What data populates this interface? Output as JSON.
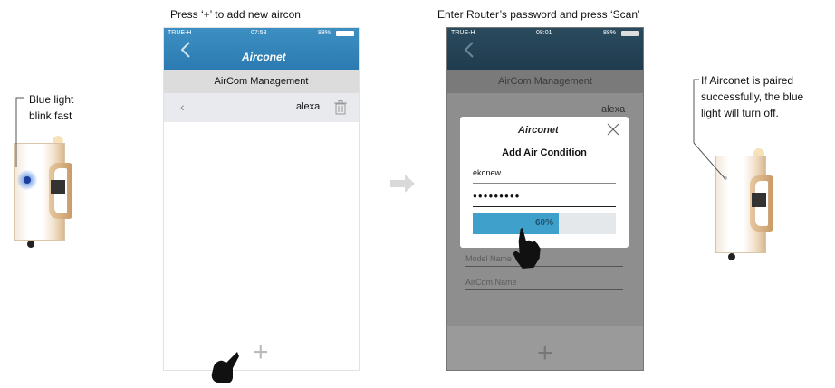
{
  "captions": {
    "step2": "Press ‘+’ to add new aircon",
    "step3": "Enter Router’s password and press ‘Scan’"
  },
  "notes": {
    "left_line1": "Blue light",
    "left_line2": "blink fast",
    "right_line1": "If Airconet is paired",
    "right_line2": "successfully, the blue",
    "right_line3": "light will turn off."
  },
  "phone1": {
    "status": {
      "carrier": "TRUE-H",
      "time": "07:58",
      "battery": "88%"
    },
    "logo": "Airconet",
    "header_title": "AirCom Management",
    "device_name": "alexa",
    "add_icon": "+"
  },
  "phone2": {
    "status": {
      "carrier": "TRUE-H",
      "time": "08:01",
      "battery": "88%"
    },
    "header_title": "AirCom Management",
    "device_name": "alexa",
    "dim_field1": "Model Name",
    "dim_field2": "AirCom Name",
    "add_icon": "+",
    "dialog": {
      "logo": "Airconet",
      "title": "Add Air Condition",
      "ssid_value": "ekonew",
      "password_value": "●●●●●●●●●",
      "progress_label": "60%",
      "progress": 0.6
    }
  },
  "colors": {
    "accent": "#2b7bb2",
    "progress": "#3fa1cb",
    "led": "#2f6fe0"
  }
}
